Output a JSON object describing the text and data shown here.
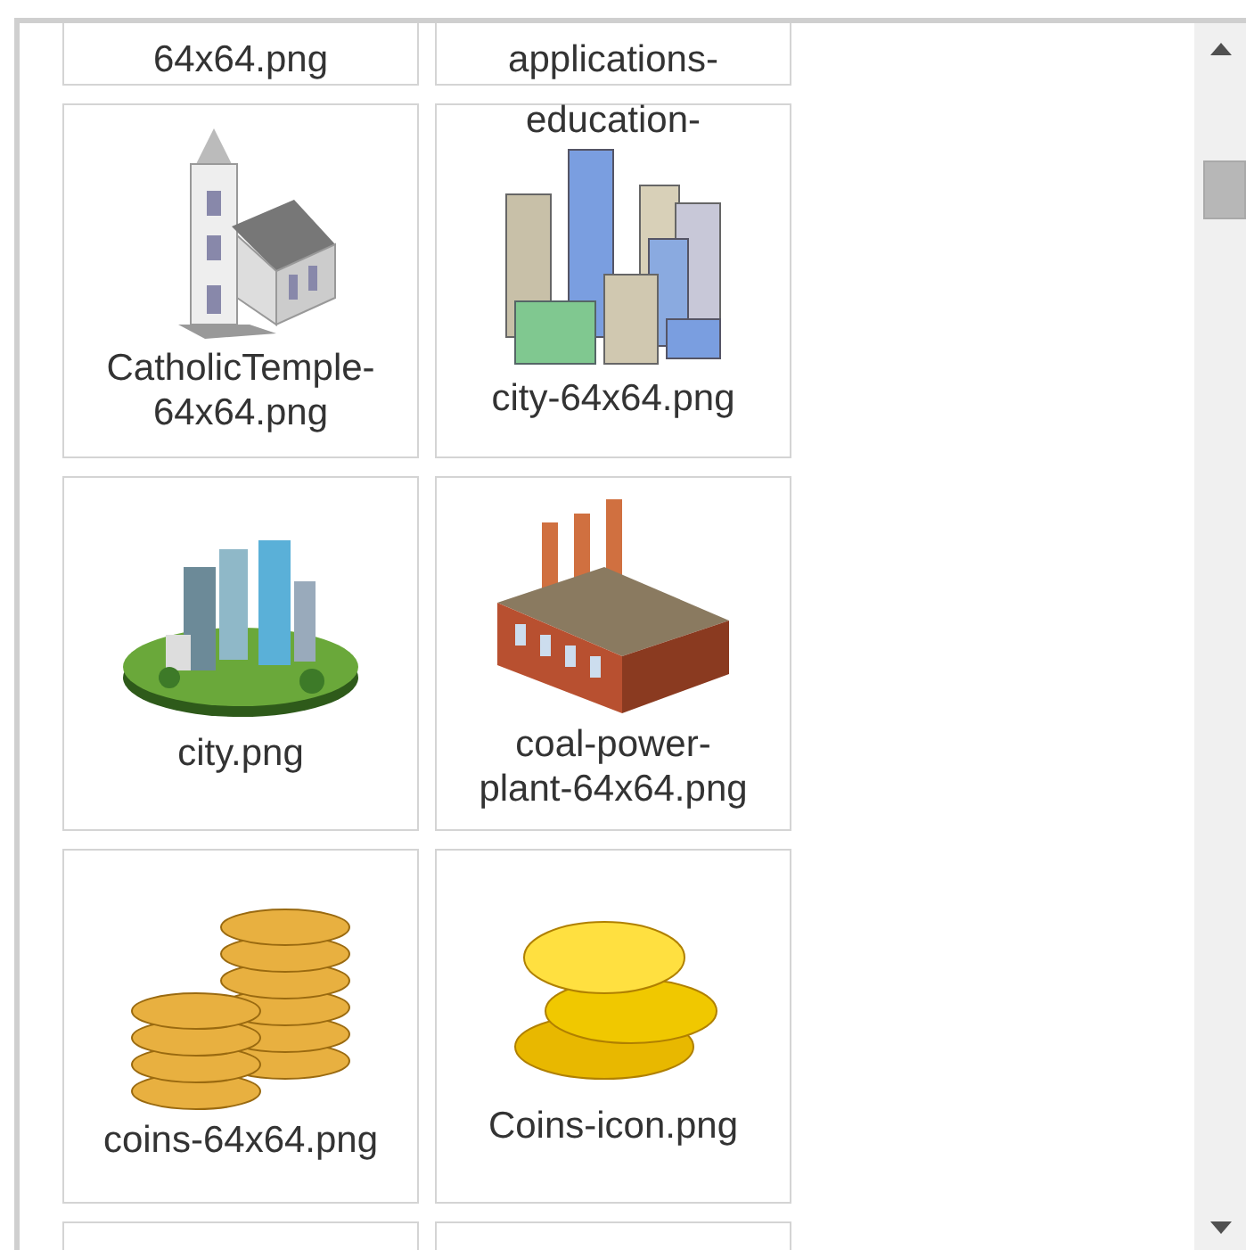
{
  "tiles": [
    {
      "kind": "cut",
      "label": "64x64.png"
    },
    {
      "kind": "cut",
      "label": "applications-",
      "overflow_label": "education-"
    },
    {
      "kind": "church",
      "label": "CatholicTemple-64x64.png"
    },
    {
      "kind": "towers",
      "label": "city-64x64.png"
    },
    {
      "kind": "island",
      "label": "city.png"
    },
    {
      "kind": "factory",
      "label": "coal-power-plant-64x64.png"
    },
    {
      "kind": "coinstack",
      "label": "coins-64x64.png"
    },
    {
      "kind": "coins",
      "label": "Coins-icon.png"
    },
    {
      "kind": "empty"
    },
    {
      "kind": "empty"
    }
  ]
}
